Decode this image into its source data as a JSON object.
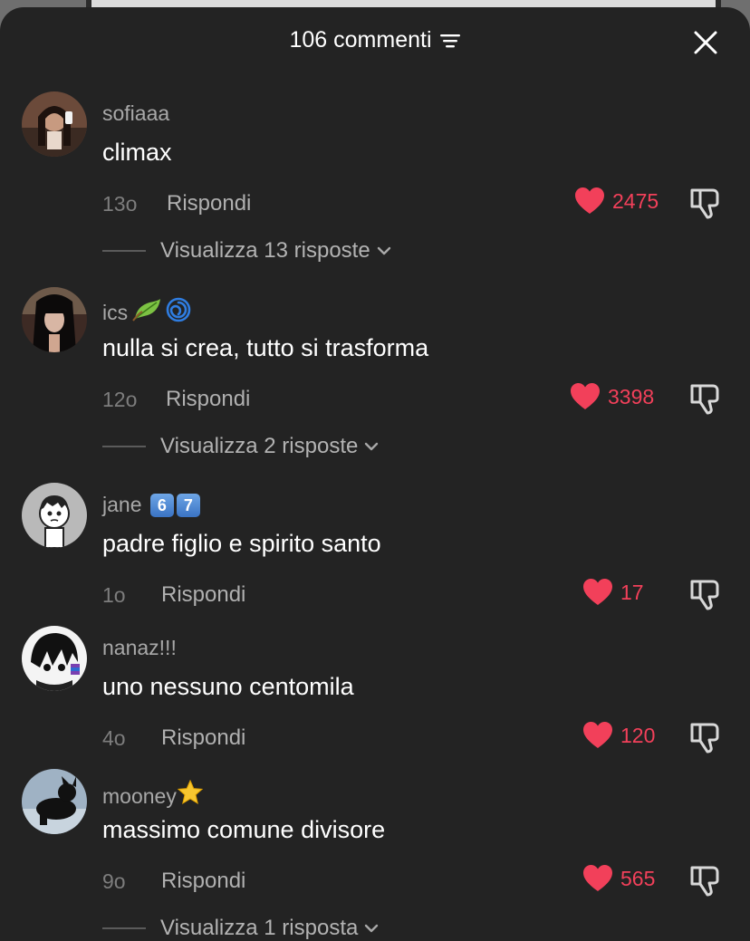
{
  "header": {
    "title": "106 commenti"
  },
  "colors": {
    "like": "#f2405a",
    "background": "#232323"
  },
  "comments": [
    {
      "username": "sofiaaa",
      "text": "climax",
      "time": "13o",
      "reply": "Rispondi",
      "likes": "2475",
      "replies": "Visualizza 13 risposte"
    },
    {
      "username": "ics",
      "text": "nulla si crea, tutto si trasforma",
      "time": "12o",
      "reply": "Rispondi",
      "likes": "3398",
      "replies": "Visualizza 2 risposte"
    },
    {
      "username": "jane",
      "badges": [
        "6",
        "7"
      ],
      "text": "padre figlio e spirito santo",
      "time": "1o",
      "reply": "Rispondi",
      "likes": "17"
    },
    {
      "username": "nanaz!!!",
      "text": "uno nessuno centomila",
      "time": "4o",
      "reply": "Rispondi",
      "likes": "120"
    },
    {
      "username": "mooney",
      "text": "massimo comune divisore",
      "time": "9o",
      "reply": "Rispondi",
      "likes": "565",
      "replies": "Visualizza 1 risposta"
    }
  ],
  "icons": [
    "filter-icon",
    "close-icon",
    "heart-icon",
    "dislike-icon",
    "chevron-down-icon",
    "leaf-emoji-icon",
    "cyclone-emoji-icon",
    "star-emoji-icon"
  ]
}
